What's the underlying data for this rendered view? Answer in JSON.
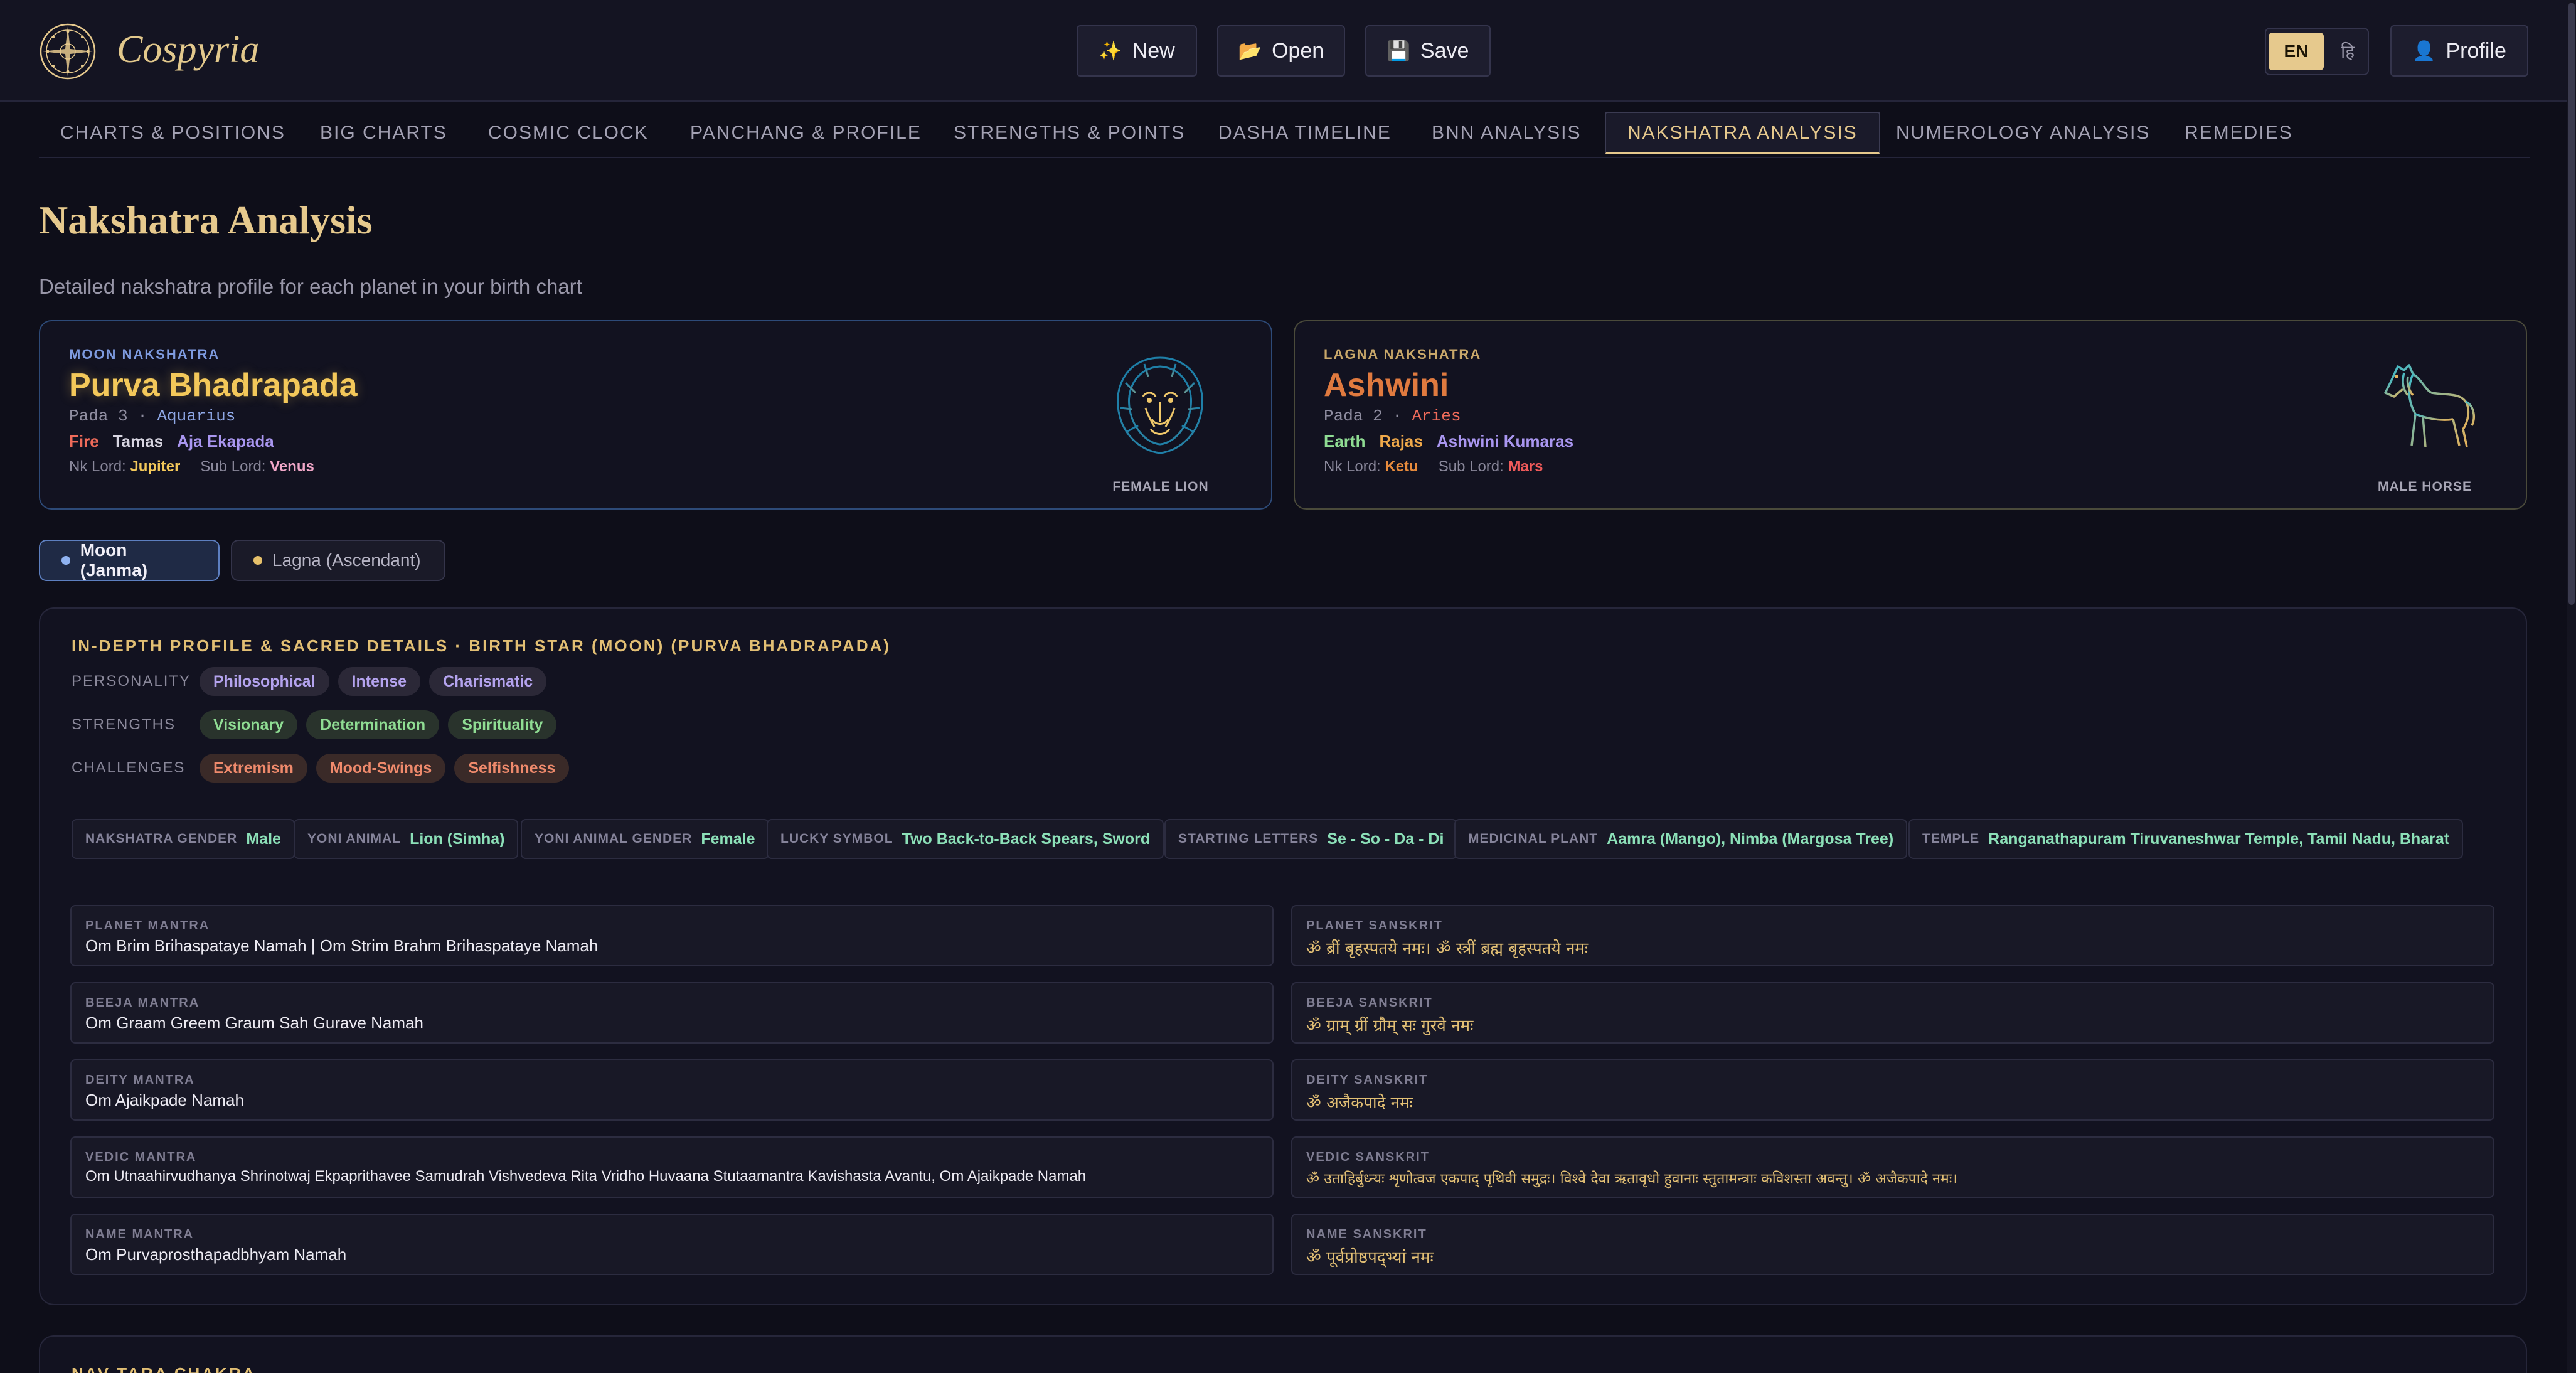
{
  "app": {
    "name": "Cospyria"
  },
  "toolbar": {
    "new_label": "New",
    "open_label": "Open",
    "save_label": "Save",
    "profile_label": "Profile",
    "new_icon": "✨",
    "open_icon": "📂",
    "save_icon": "💾",
    "profile_icon": "👤"
  },
  "language": {
    "en": "EN",
    "hi": "हि"
  },
  "tabs": [
    {
      "label": "CHARTS & POSITIONS"
    },
    {
      "label": "BIG CHARTS"
    },
    {
      "label": "COSMIC CLOCK"
    },
    {
      "label": "PANCHANG & PROFILE"
    },
    {
      "label": "STRENGTHS & POINTS"
    },
    {
      "label": "DASHA TIMELINE"
    },
    {
      "label": "BNN ANALYSIS"
    },
    {
      "label": "NAKSHATRA ANALYSIS",
      "active": true
    },
    {
      "label": "NUMEROLOGY ANALYSIS"
    },
    {
      "label": "REMEDIES"
    }
  ],
  "page": {
    "title": "Nakshatra Analysis",
    "subtitle": "Detailed nakshatra profile for each planet in your birth chart"
  },
  "moon_card": {
    "kicker": "MOON NAKSHATRA",
    "name": "Purva Bhadrapada",
    "pada": "Pada 3",
    "sep": "·",
    "sign": "Aquarius",
    "element": "Fire",
    "guna": "Tamas",
    "deity": "Aja Ekapada",
    "nk_lord_label": "Nk Lord:",
    "nk_lord": "Jupiter",
    "sub_lord_label": "Sub Lord:",
    "sub_lord": "Venus",
    "animal_label": "FEMALE LION"
  },
  "lagna_card": {
    "kicker": "LAGNA NAKSHATRA",
    "name": "Ashwini",
    "pada": "Pada 2",
    "sep": "·",
    "sign": "Aries",
    "element": "Earth",
    "guna": "Rajas",
    "deity": "Ashwini Kumaras",
    "nk_lord_label": "Nk Lord:",
    "nk_lord": "Ketu",
    "sub_lord_label": "Sub Lord:",
    "sub_lord": "Mars",
    "animal_label": "MALE HORSE"
  },
  "toggles": {
    "moon": "Moon (Janma)",
    "lagna": "Lagna (Ascendant)"
  },
  "profile": {
    "title": "IN-DEPTH PROFILE & SACRED DETAILS · BIRTH STAR (MOON) (PURVA BHADRAPADA)",
    "personality_label": "PERSONALITY",
    "personality": [
      "Philosophical",
      "Intense",
      "Charismatic"
    ],
    "strengths_label": "STRENGTHS",
    "strengths": [
      "Visionary",
      "Determination",
      "Spirituality"
    ],
    "challenges_label": "CHALLENGES",
    "challenges": [
      "Extremism",
      "Mood-Swings",
      "Selfishness"
    ],
    "facts": [
      {
        "label": "NAKSHATRA GENDER",
        "value": "Male"
      },
      {
        "label": "YONI ANIMAL",
        "value": "Lion (Simha)"
      },
      {
        "label": "YONI ANIMAL GENDER",
        "value": "Female"
      },
      {
        "label": "LUCKY SYMBOL",
        "value": "Two Back-to-Back Spears, Sword"
      },
      {
        "label": "STARTING LETTERS",
        "value": "Se - So - Da - Di"
      },
      {
        "label": "MEDICINAL PLANT",
        "value": "Aamra (Mango), Nimba (Margosa Tree)"
      },
      {
        "label": "TEMPLE",
        "value": "Ranganathapuram Tiruvaneshwar Temple, Tamil Nadu, Bharat"
      }
    ],
    "mantras": [
      {
        "label": "PLANET MANTRA",
        "value": "Om Brim Brihaspataye Namah | Om Strim Brahm Brihaspataye Namah",
        "sk_label": "PLANET SANSKRIT",
        "sk_value": "ॐ ब्रीं बृहस्पतये नमः। ॐ स्त्रीं ब्रह्म बृहस्पतये नमः"
      },
      {
        "label": "BEEJA MANTRA",
        "value": "Om Graam Greem Graum Sah Gurave Namah",
        "sk_label": "BEEJA SANSKRIT",
        "sk_value": "ॐ ग्राम् ग्रीं ग्रौम् सः गुरवे नमः"
      },
      {
        "label": "DEITY MANTRA",
        "value": "Om Ajaikpade Namah",
        "sk_label": "DEITY SANSKRIT",
        "sk_value": "ॐ अजैकपादे नमः"
      },
      {
        "label": "VEDIC MANTRA",
        "value": "Om Utnaahirvudhanya Shrinotwaj Ekpaprithavee Samudrah Vishvedeva Rita Vridho Huvaana Stutaamantra Kavishasta Avantu, Om Ajaikpade Namah",
        "sk_label": "VEDIC SANSKRIT",
        "sk_value": "ॐ उताहिर्बुध्न्यः शृणोत्वज एकपाद् पृथिवी समुद्रः। विश्वे देवा ऋतावृधो हुवानाः स्तुतामन्त्राः कविशस्ता अवन्तु। ॐ अजैकपादे नमः।"
      },
      {
        "label": "NAME MANTRA",
        "value": "Om Purvaprosthapadbhyam Namah",
        "sk_label": "NAME SANSKRIT",
        "sk_value": "ॐ पूर्वप्रोष्ठपद्भ्यां नमः"
      }
    ]
  },
  "nav_tara": {
    "title": "NAV TARA CHAKRA"
  },
  "colors": {
    "accent_gold": "#e6c98d",
    "moon_name": "#f3c85a",
    "lagna_name": "#e07a3f",
    "fire": "#ef6b5a",
    "earth": "#8fdc93",
    "deity": "#a996f0",
    "jupiter": "#f3c85a",
    "venus": "#f1a7c8",
    "ketu": "#e88b3c",
    "mars": "#ef5a5a"
  }
}
